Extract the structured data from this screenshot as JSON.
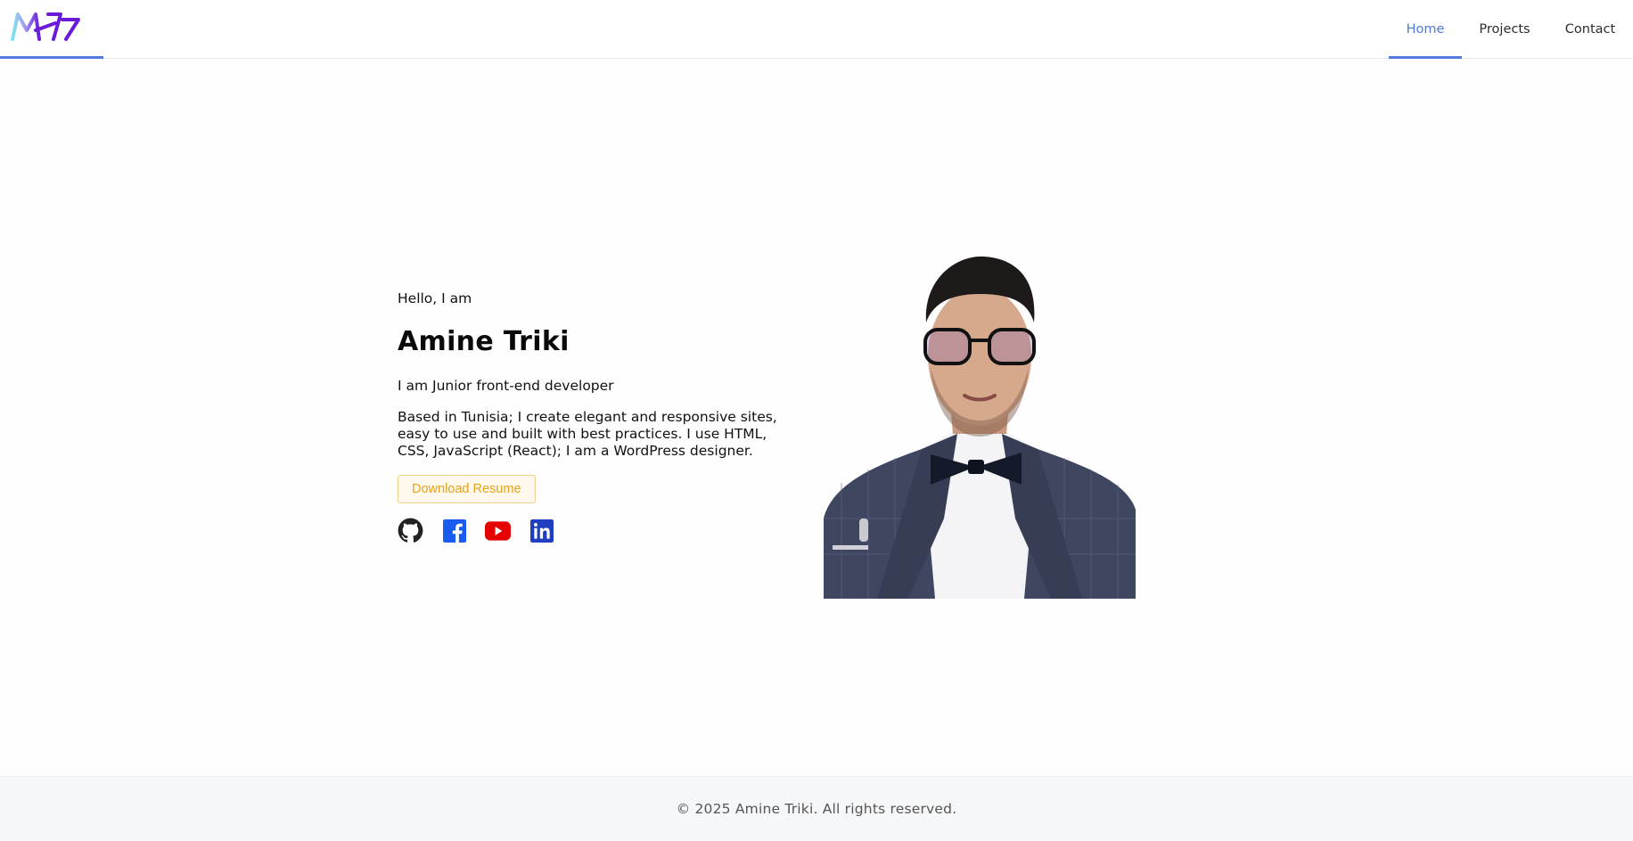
{
  "header": {
    "logo_icon": "ma-monogram-logo",
    "nav": [
      {
        "label": "Home",
        "active": true
      },
      {
        "label": "Projects",
        "active": false
      },
      {
        "label": "Contact",
        "active": false
      }
    ]
  },
  "hero": {
    "greeting": "Hello, I am",
    "name": "Amine Triki",
    "role": "I am Junior front-end developer",
    "bio": "Based in Tunisia; I create elegant and responsive sites, easy to use and built with best practices. I use HTML, CSS, JavaScript (React); I am a WordPress designer.",
    "resume_button": "Download Resume",
    "socials": [
      {
        "icon": "github-icon",
        "color": "#222222"
      },
      {
        "icon": "facebook-icon",
        "color": "#1a5cf0"
      },
      {
        "icon": "youtube-icon",
        "color": "#e60000"
      },
      {
        "icon": "linkedin-icon",
        "color": "#1f3fc0"
      }
    ],
    "portrait": "portrait-photo"
  },
  "footer": {
    "copyright": "© 2025 Amine Triki. All rights reserved."
  },
  "colors": {
    "accent": "#4f7be0",
    "resume_text": "#e6a21e",
    "resume_border": "#f2cf8d",
    "footer_bg": "#f6f7f9"
  }
}
